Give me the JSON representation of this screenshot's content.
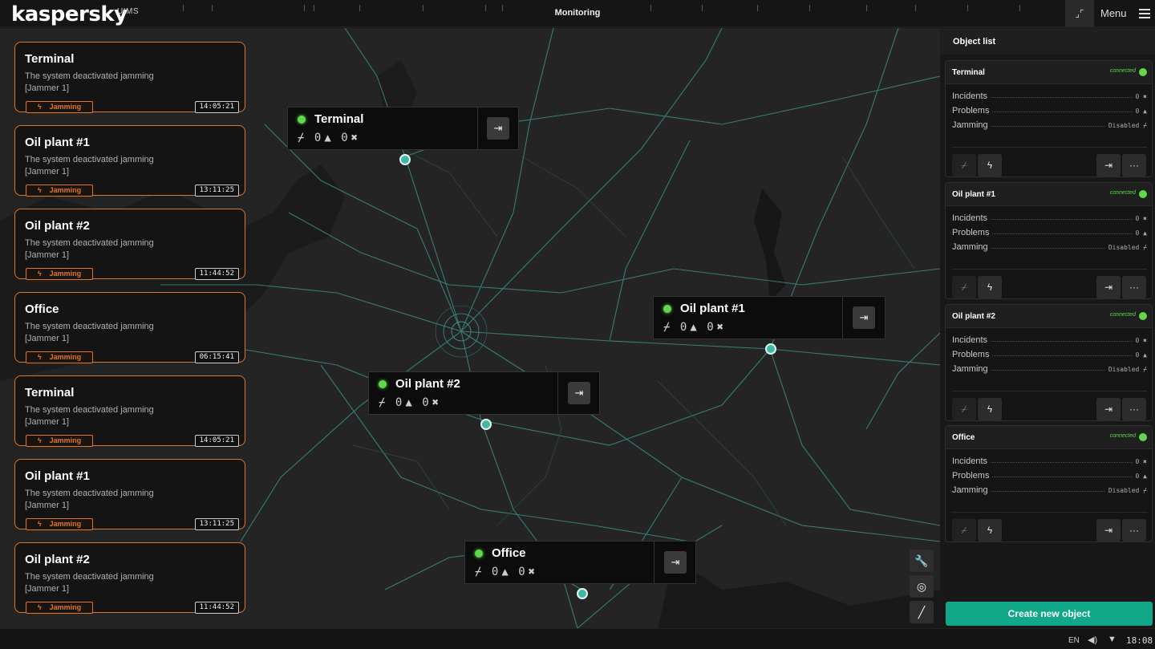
{
  "app": {
    "logo": "kaspersky",
    "logo_sub": "UIMS",
    "title": "Monitoring",
    "menu_label": "Menu"
  },
  "events": [
    {
      "title": "Terminal",
      "desc": "The system deactivated jamming",
      "source": "[Jammer 1]",
      "tag": "Jamming",
      "time": "14:05:21"
    },
    {
      "title": "Oil plant #1",
      "desc": "The system deactivated jamming",
      "source": "[Jammer 1]",
      "tag": "Jamming",
      "time": "13:11:25"
    },
    {
      "title": "Oil plant #2",
      "desc": "The system deactivated jamming",
      "source": "[Jammer 1]",
      "tag": "Jamming",
      "time": "11:44:52"
    },
    {
      "title": "Office",
      "desc": "The system deactivated jamming",
      "source": "[Jammer 1]",
      "tag": "Jamming",
      "time": "06:15:41"
    },
    {
      "title": "Terminal",
      "desc": "The system deactivated jamming",
      "source": "[Jammer 1]",
      "tag": "Jamming",
      "time": "14:05:21"
    },
    {
      "title": "Oil plant #1",
      "desc": "The system deactivated jamming",
      "source": "[Jammer 1]",
      "tag": "Jamming",
      "time": "13:11:25"
    },
    {
      "title": "Oil plant #2",
      "desc": "The system deactivated jamming",
      "source": "[Jammer 1]",
      "tag": "Jamming",
      "time": "11:44:52"
    }
  ],
  "map_popups": [
    {
      "name": "Terminal",
      "problems": "0",
      "incidents": "0"
    },
    {
      "name": "Oil plant #1",
      "problems": "0",
      "incidents": "0"
    },
    {
      "name": "Oil plant #2",
      "problems": "0",
      "incidents": "0"
    },
    {
      "name": "Office",
      "problems": "0",
      "incidents": "0"
    }
  ],
  "object_list": {
    "title": "Object list",
    "labels": {
      "incidents": "Incidents",
      "problems": "Problems",
      "jamming": "Jamming"
    },
    "objects": [
      {
        "name": "Terminal",
        "status": "connected",
        "incidents": "0",
        "problems": "0",
        "jamming": "Disabled"
      },
      {
        "name": "Oil plant #1",
        "status": "connected",
        "incidents": "0",
        "problems": "0",
        "jamming": "Disabled"
      },
      {
        "name": "Oil plant #2",
        "status": "connected",
        "incidents": "0",
        "problems": "0",
        "jamming": "Disabled"
      },
      {
        "name": "Office",
        "status": "connected",
        "incidents": "0",
        "problems": "0",
        "jamming": "Disabled"
      }
    ],
    "create_label": "Create new object"
  },
  "statusbar": {
    "lang": "EN",
    "time": "18:08"
  },
  "colors": {
    "accent": "#11a889",
    "alert": "#e0762a",
    "connected": "#5fd84a",
    "road": "#3fb9a4"
  },
  "icons": [
    "collapse-icon",
    "hamburger-icon",
    "bolt-icon",
    "jamming-off-icon",
    "warning-icon",
    "tools-icon",
    "enter-icon",
    "more-icon",
    "wrench-icon",
    "target-icon",
    "ruler-icon",
    "volume-icon",
    "wifi-icon"
  ]
}
